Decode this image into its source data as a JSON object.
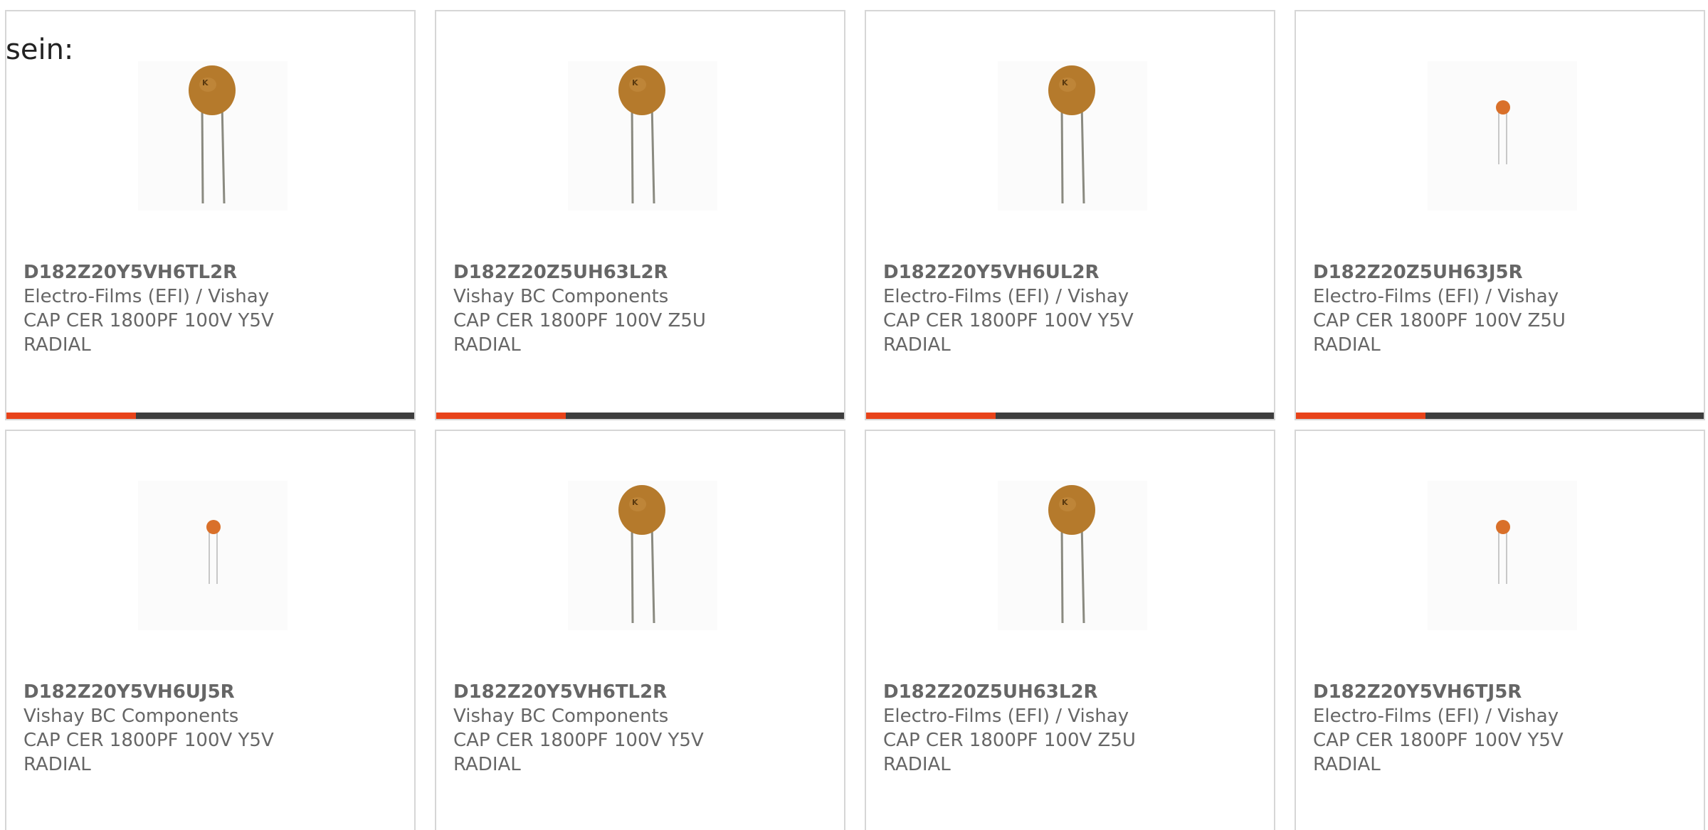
{
  "lead_text": "sein:",
  "colors": {
    "accent": "#e8431a",
    "bar_dark": "#3d3d3d",
    "capacitor_large": "#b57a2c",
    "capacitor_small": "#d9702a",
    "lead_wire": "#8a8a80"
  },
  "products": [
    {
      "part_number": "D182Z20Y5VH6TL2R",
      "manufacturer": "Electro-Films (EFI) / Vishay",
      "description": "CAP CER 1800PF 100V Y5V",
      "package": "RADIAL",
      "image_icon": "large-disc-capacitor-icon"
    },
    {
      "part_number": "D182Z20Z5UH63L2R",
      "manufacturer": "Vishay BC Components",
      "description": "CAP CER 1800PF 100V Z5U",
      "package": "RADIAL",
      "image_icon": "large-disc-capacitor-icon"
    },
    {
      "part_number": "D182Z20Y5VH6UL2R",
      "manufacturer": "Electro-Films (EFI) / Vishay",
      "description": "CAP CER 1800PF 100V Y5V",
      "package": "RADIAL",
      "image_icon": "large-disc-capacitor-icon"
    },
    {
      "part_number": "D182Z20Z5UH63J5R",
      "manufacturer": "Electro-Films (EFI) / Vishay",
      "description": "CAP CER 1800PF 100V Z5U",
      "package": "RADIAL",
      "image_icon": "small-disc-capacitor-icon"
    },
    {
      "part_number": "D182Z20Y5VH6UJ5R",
      "manufacturer": "Vishay BC Components",
      "description": "CAP CER 1800PF 100V Y5V",
      "package": "RADIAL",
      "image_icon": "small-disc-capacitor-icon"
    },
    {
      "part_number": "D182Z20Y5VH6TL2R",
      "manufacturer": "Vishay BC Components",
      "description": "CAP CER 1800PF 100V Y5V",
      "package": "RADIAL",
      "image_icon": "large-disc-capacitor-icon"
    },
    {
      "part_number": "D182Z20Z5UH63L2R",
      "manufacturer": "Electro-Films (EFI) / Vishay",
      "description": "CAP CER 1800PF 100V Z5U",
      "package": "RADIAL",
      "image_icon": "large-disc-capacitor-icon"
    },
    {
      "part_number": "D182Z20Y5VH6TJ5R",
      "manufacturer": "Electro-Films (EFI) / Vishay",
      "description": "CAP CER 1800PF 100V Y5V",
      "package": "RADIAL",
      "image_icon": "small-disc-capacitor-icon"
    }
  ]
}
